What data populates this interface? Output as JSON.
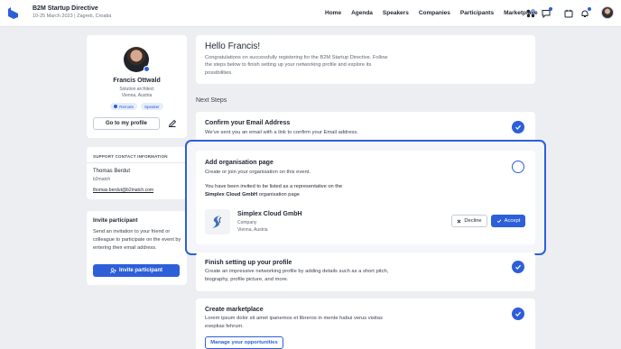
{
  "header": {
    "event_title": "B2M Startup Directive",
    "event_subtitle": "10-25 March 2023 | Zagreb, Croatia",
    "nav": [
      "Home",
      "Agenda",
      "Speakers",
      "Companies",
      "Participants",
      "Marketplace"
    ],
    "icons": [
      "apps-icon",
      "chat-icon",
      "calendar-icon",
      "bell-icon"
    ]
  },
  "profile": {
    "name": "Francis Ottwald",
    "role": "Solution architect",
    "location": "Vienna, Austria",
    "tags": [
      "Remote",
      "Speaker"
    ],
    "my_profile_label": "Go to my profile"
  },
  "support": {
    "heading": "SUPPORT CONTACT INFORMATION",
    "name": "Thomas Berdut",
    "org": "b2match",
    "email": "thomas.berdut@b2match.com"
  },
  "invite": {
    "title": "Invite participant",
    "text": "Send an invitation to your friend or colleague to participate on the event by entering their email address.",
    "button_label": "Invite participant"
  },
  "hello": {
    "title": "Hello Francis!",
    "text": "Congratulations on successfully registering for the B2M Startup Directive. Follow the steps below to finish setting up your networking profile and explore its possibilities."
  },
  "next_steps_label": "Next Steps",
  "steps": {
    "email": {
      "title": "Confirm your Email Address",
      "text": "We've sent you an email with a link to confirm your Email address."
    },
    "organisation": {
      "title": "Add organisation page",
      "text": "Create or join your organisation on this event.",
      "invite_line1": "You have been invited to be listed as a representative on the",
      "invite_company": "Simplex Cloud GmbH",
      "invite_line2": " organisation page",
      "company_name": "Simplex Cloud GmbH",
      "company_type": "Company",
      "company_location": "Vienna, Austria",
      "decline_label": "Decline",
      "accept_label": "Accept"
    },
    "profile": {
      "title": "Finish setting up your profile",
      "text": "Create an impressive networking profile by adding details such as a short pitch, biography, profile picture, and more."
    },
    "marketplace": {
      "title": "Create marketplace",
      "text": "Lorem ipsum dolor sit amet ipanemos et libreros in mente habui verus visitas exeptias fehrum.",
      "button_label": "Manage your opportunities"
    }
  },
  "colors": {
    "accent": "#2d5fd9",
    "background": "#eceef2"
  }
}
